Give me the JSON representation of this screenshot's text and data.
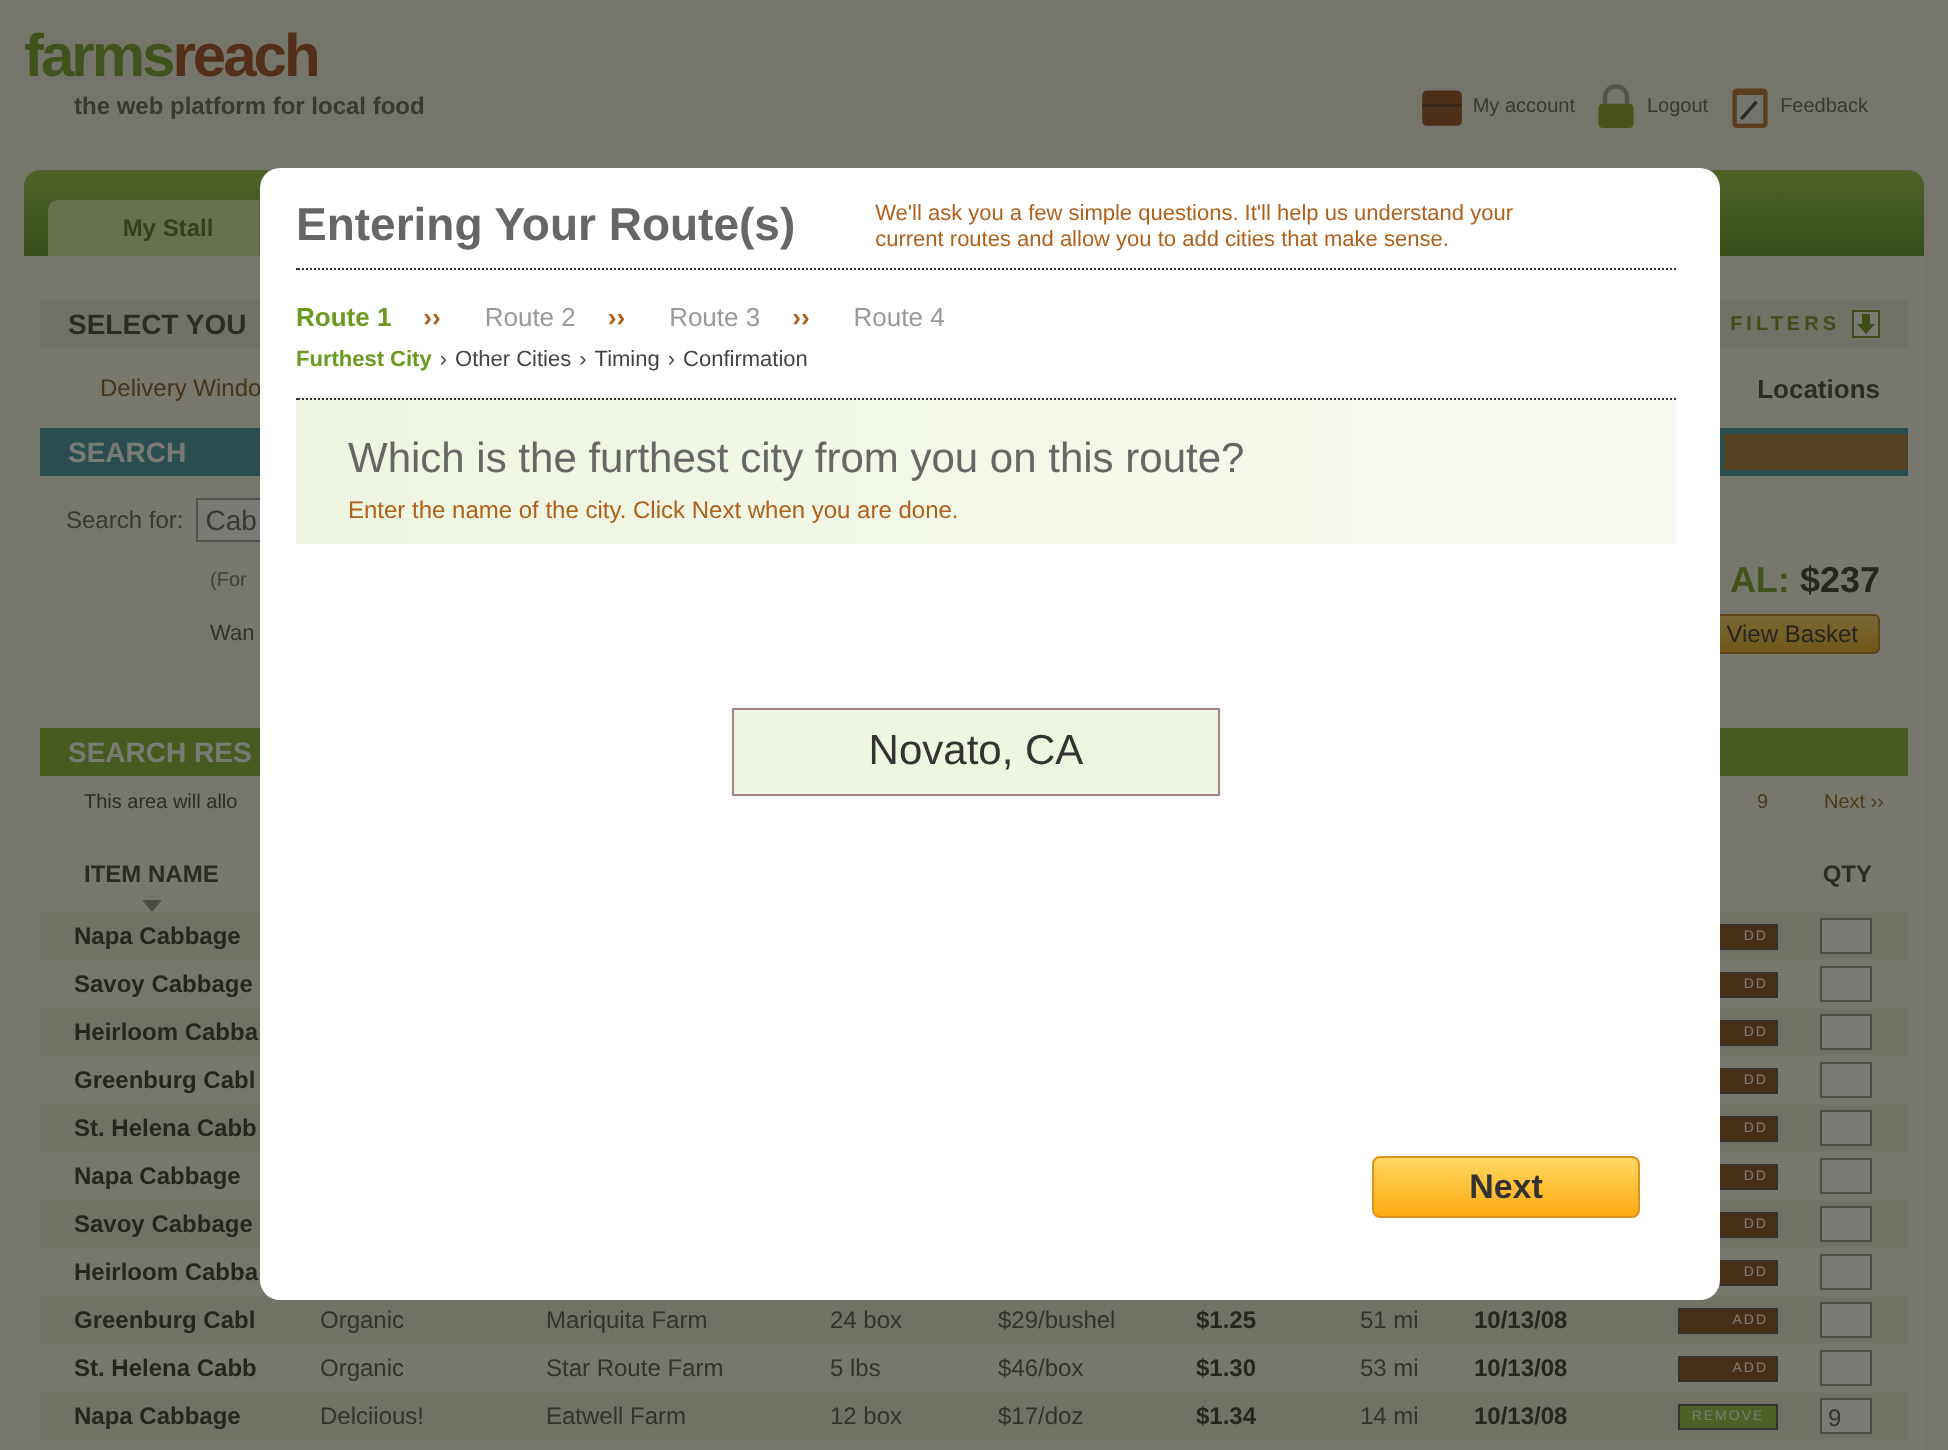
{
  "header": {
    "logo": [
      "farms",
      "reach"
    ],
    "tagline": "the web platform for local food",
    "links": [
      {
        "label": "My account",
        "kind": "account"
      },
      {
        "label": "Logout",
        "kind": "lock"
      },
      {
        "label": "Feedback",
        "kind": "note"
      }
    ]
  },
  "nav": {
    "tabs": [
      {
        "label": "My Stall",
        "selected": true
      }
    ]
  },
  "background": {
    "select_bar": "SELECT YOU",
    "filters": "FILTERS",
    "delivery": "Delivery Windo",
    "locations": "Locations",
    "search_title": "SEARCH",
    "search_label": "Search for:",
    "search_value": "Cab",
    "search_hint": "(For",
    "want": "Wan",
    "total_label": "AL:",
    "total_value": "$237",
    "basket_button": "View Basket",
    "results_title": "SEARCH RES",
    "results_note": "This area will allo",
    "page": "9",
    "next": "Next ››",
    "col_item": "ITEM NAME",
    "col_qty": "QTY"
  },
  "rows": [
    {
      "cells": [
        "Napa Cabbage"
      ],
      "action": "DD",
      "kind": "add",
      "qty": ""
    },
    {
      "cells": [
        "Savoy Cabbage"
      ],
      "action": "DD",
      "kind": "add",
      "qty": ""
    },
    {
      "cells": [
        "Heirloom Cabba"
      ],
      "action": "DD",
      "kind": "add",
      "qty": ""
    },
    {
      "cells": [
        "Greenburg Cabl"
      ],
      "action": "DD",
      "kind": "add",
      "qty": ""
    },
    {
      "cells": [
        "St. Helena Cabb"
      ],
      "action": "DD",
      "kind": "add",
      "qty": ""
    },
    {
      "cells": [
        "Napa Cabbage"
      ],
      "action": "DD",
      "kind": "add",
      "qty": ""
    },
    {
      "cells": [
        "Savoy Cabbage"
      ],
      "action": "DD",
      "kind": "add",
      "qty": ""
    },
    {
      "cells": [
        "Heirloom Cabba"
      ],
      "action": "DD",
      "kind": "add",
      "qty": ""
    },
    {
      "cells": [
        "Greenburg Cabl",
        "Organic",
        "Mariquita Farm",
        "24 box",
        "$29/bushel",
        "$1.25",
        "51 mi",
        "10/13/08"
      ],
      "action": "ADD",
      "kind": "add",
      "qty": ""
    },
    {
      "cells": [
        "St. Helena Cabb",
        "Organic",
        "Star Route Farm",
        "5 lbs",
        "$46/box",
        "$1.30",
        "53 mi",
        "10/13/08"
      ],
      "action": "ADD",
      "kind": "add",
      "qty": ""
    },
    {
      "cells": [
        "Napa Cabbage",
        "Delciious!",
        "Eatwell Farm",
        "12 box",
        "$17/doz",
        "$1.34",
        "14 mi",
        "10/13/08"
      ],
      "action": "REMOVE",
      "kind": "remove",
      "qty": "9"
    }
  ],
  "dialog": {
    "title": "Entering Your Route(s)",
    "intro": "We'll ask you a few simple questions. It'll help us understand your current routes and allow you to add cities that make sense.",
    "routes": [
      {
        "label": "Route 1",
        "selected": true
      },
      {
        "label": "Route 2",
        "selected": false
      },
      {
        "label": "Route 3",
        "selected": false
      },
      {
        "label": "Route 4",
        "selected": false
      }
    ],
    "route_separator": "››",
    "steps": [
      {
        "label": "Furthest City",
        "selected": true
      },
      {
        "label": "Other Cities",
        "selected": false
      },
      {
        "label": "Timing",
        "selected": false
      },
      {
        "label": "Confirmation",
        "selected": false
      }
    ],
    "step_separator": "›",
    "question": "Which is the furthest city from you on this route?",
    "hint": "Enter the name of the city. Click Next when you are done.",
    "city": "Novato, CA",
    "next": "Next"
  }
}
